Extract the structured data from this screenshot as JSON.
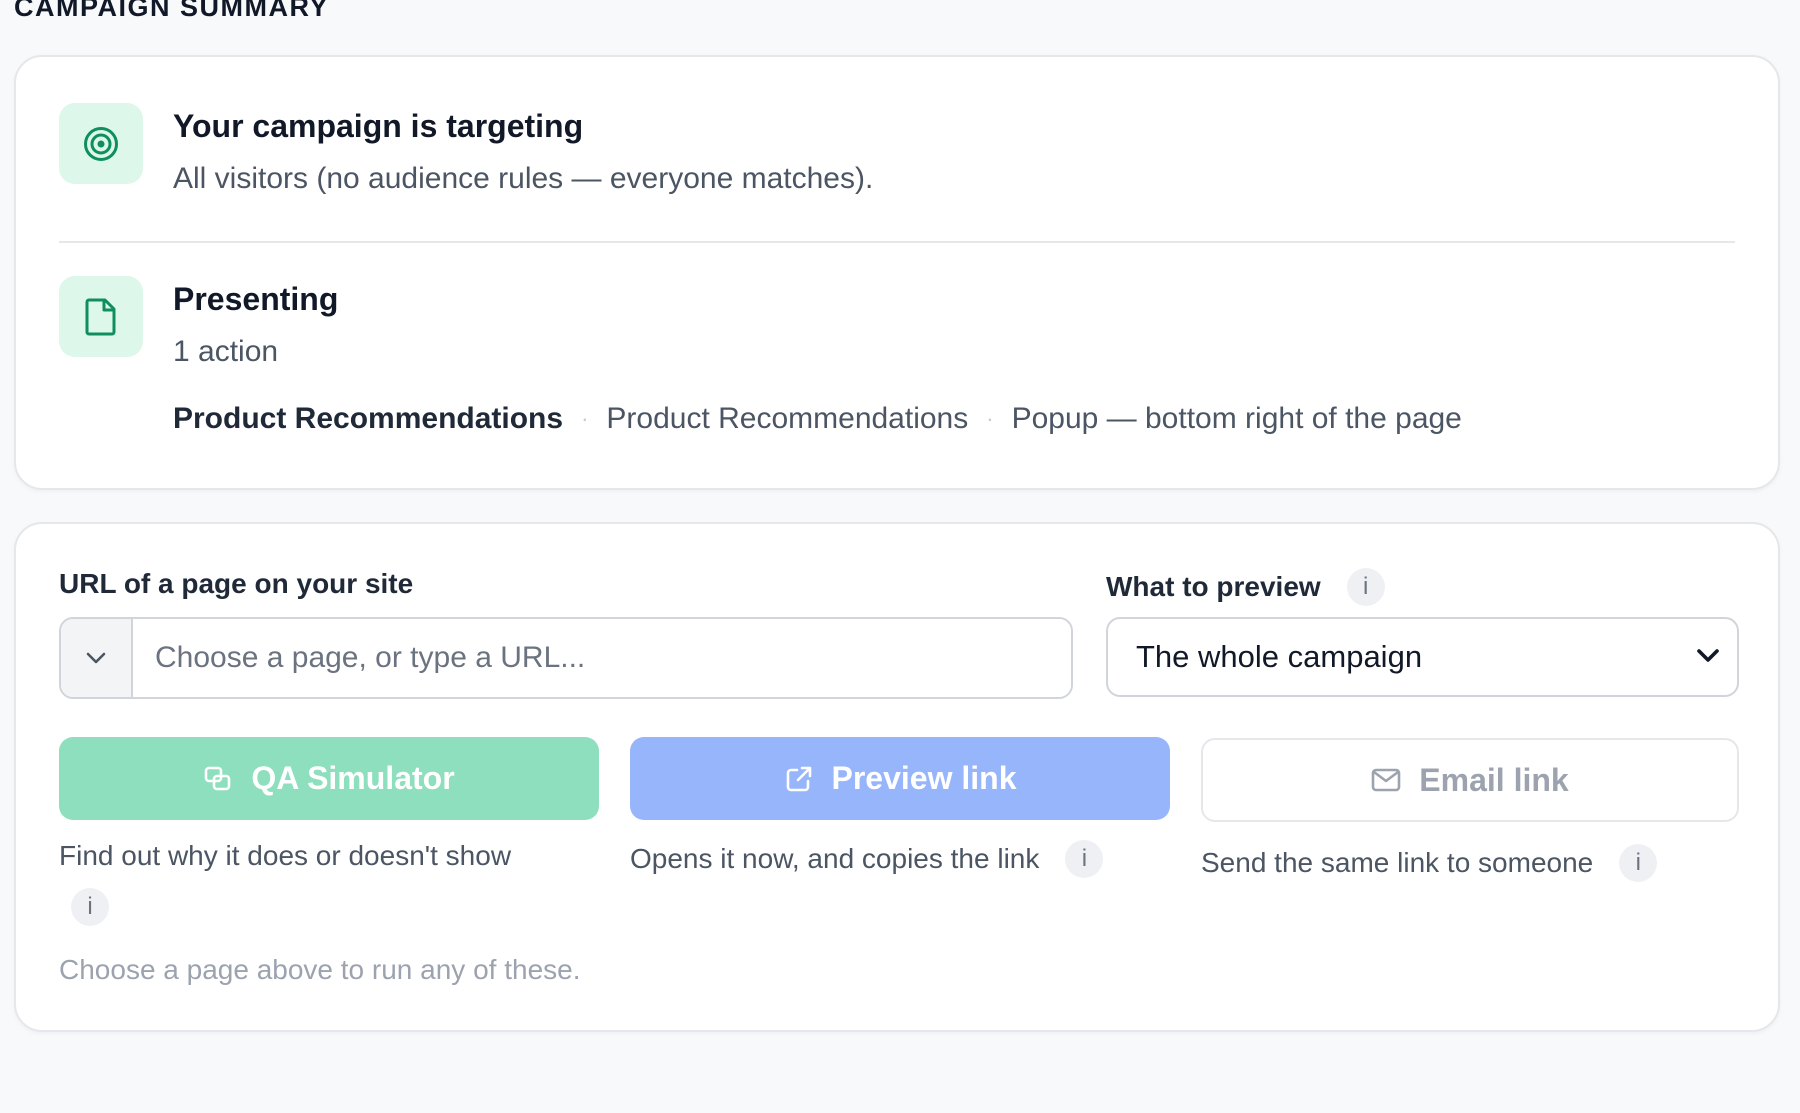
{
  "section_title": "CAMPAIGN SUMMARY",
  "summary": {
    "targeting": {
      "icon": "target-icon",
      "title": "Your campaign is targeting",
      "subtitle": "All visitors (no audience rules — everyone matches)."
    },
    "presenting": {
      "icon": "document-icon",
      "title": "Presenting",
      "subtitle": "1 action",
      "action": {
        "name": "Product Recommendations",
        "type": "Product Recommendations",
        "placement": "Popup — bottom right of the page"
      }
    }
  },
  "preview": {
    "url_label": "URL of a page on your site",
    "url_placeholder": "Choose a page, or type a URL...",
    "url_value": "",
    "what_label": "What to preview",
    "what_selected": "The whole campaign",
    "buttons": {
      "qa": {
        "label": "QA Simulator",
        "icon": "simulator-icon",
        "help": "Find out why it does or doesn't show"
      },
      "preview": {
        "label": "Preview link",
        "icon": "external-link-icon",
        "help": "Opens it now, and copies the link"
      },
      "email": {
        "label": "Email link",
        "icon": "mail-icon",
        "help": "Send the same link to someone"
      }
    },
    "info_glyph": "i",
    "hint": "Choose a page above to run any of these."
  },
  "colors": {
    "accent_green": "#0f8f5e",
    "icon_bg": "#ddf7ea",
    "qa_button": "#8ddfbe",
    "preview_button": "#97b5fb"
  }
}
